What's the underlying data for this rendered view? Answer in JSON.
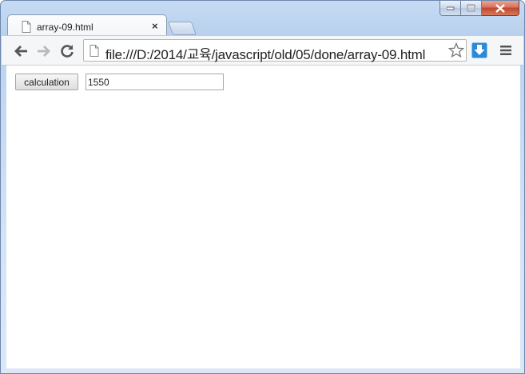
{
  "tab": {
    "title": "array-09.html",
    "close_glyph": "×"
  },
  "address": {
    "url": "file:///D:/2014/교육/javascript/old/05/done/array-09.html"
  },
  "icons": {
    "back": "back-arrow-icon",
    "forward": "forward-arrow-icon",
    "reload": "reload-icon",
    "page": "page-icon",
    "star": "star-icon",
    "download": "download-icon",
    "menu": "hamburger-menu-icon",
    "minimize": "minimize-icon",
    "maximize": "maximize-icon",
    "close": "close-icon"
  },
  "colors": {
    "close_button": "#c7482f",
    "download_accent": "#2b8ad8",
    "frame": "#c3d7f0"
  },
  "page": {
    "button_label": "calculation",
    "result_value": "1550"
  }
}
